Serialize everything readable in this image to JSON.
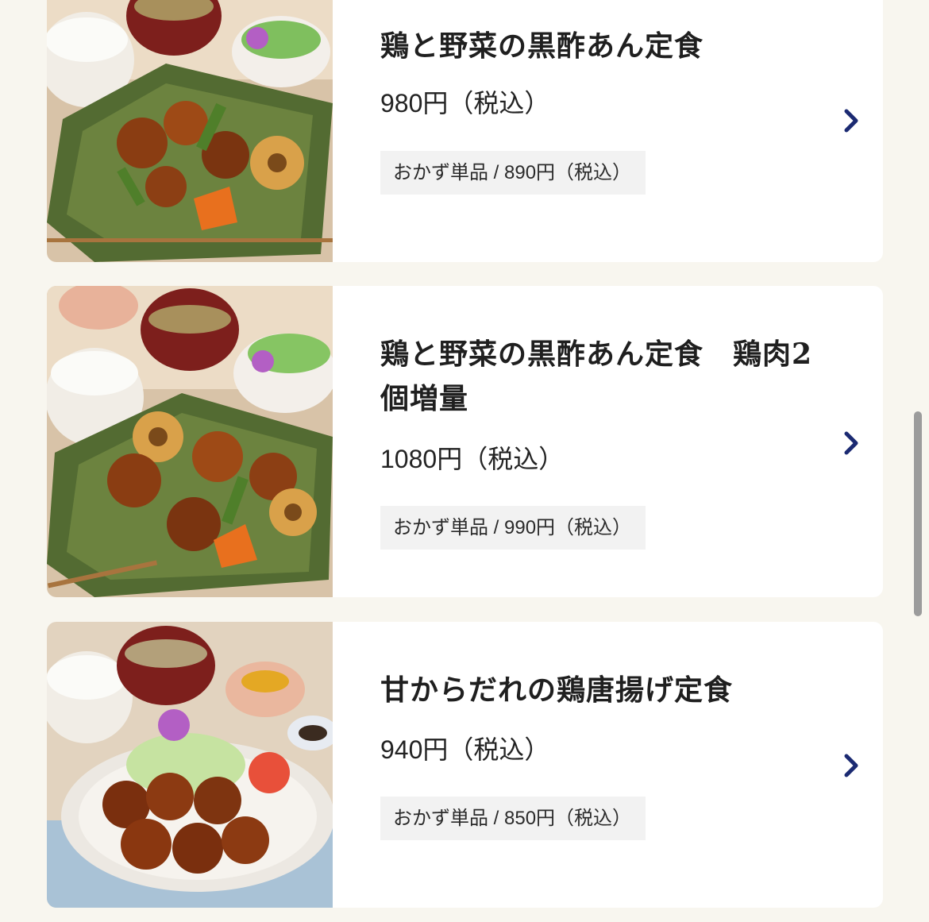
{
  "items": [
    {
      "title": "鶏と野菜の黒酢あん定食",
      "price": "980円（税込）",
      "single": "おかず単品 / 890円（税込）",
      "icon": "chevron-right-icon"
    },
    {
      "title": "鶏と野菜の黒酢あん定食　鶏肉2個増量",
      "price": "1080円（税込）",
      "single": "おかず単品 / 990円（税込）",
      "icon": "chevron-right-icon"
    },
    {
      "title": "甘からだれの鶏唐揚げ定食",
      "price": "940円（税込）",
      "single": "おかず単品 / 850円（税込）",
      "icon": "chevron-right-icon"
    }
  ],
  "colors": {
    "page_background": "#f8f6ef",
    "card_background": "#ffffff",
    "badge_background": "#f2f2f2",
    "chevron": "#1b2a72",
    "scrollbar": "#9c9c9c"
  }
}
